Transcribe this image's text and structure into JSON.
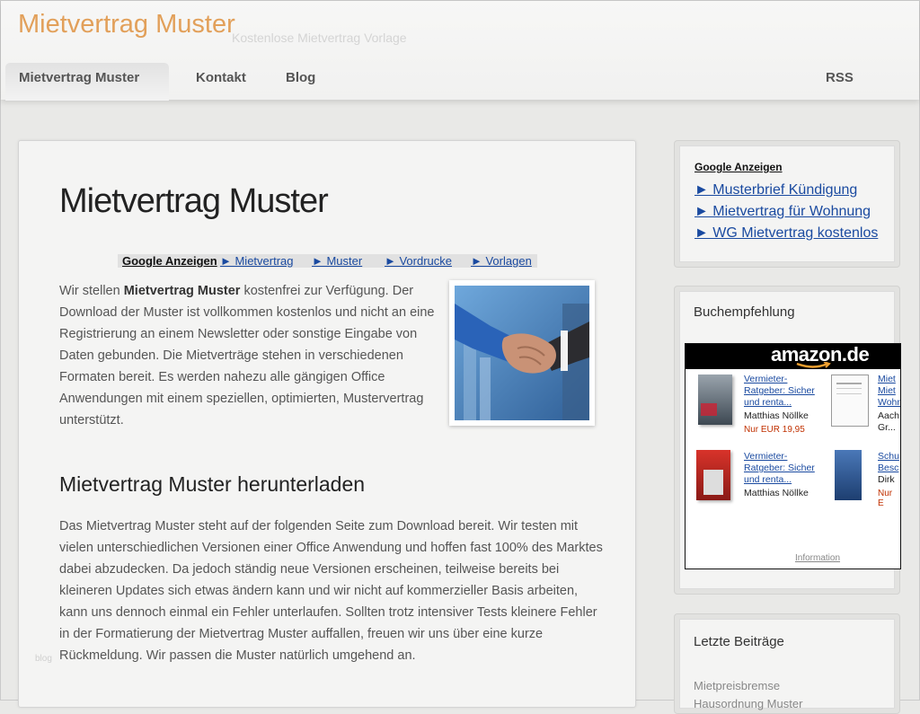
{
  "header": {
    "site_title": "Mietvertrag Muster",
    "tagline": "Kostenlose Mietvertrag Vorlage",
    "nav": [
      {
        "label": "Mietvertrag Muster",
        "active": true
      },
      {
        "label": "Kontakt"
      },
      {
        "label": "Blog"
      },
      {
        "label": "RSS"
      }
    ]
  },
  "main": {
    "heading": "Mietvertrag Muster",
    "ads": {
      "label": "Google Anzeigen",
      "links": [
        "► Mietvertrag",
        "► Muster",
        "► Vordrucke",
        "► Vorlagen"
      ]
    },
    "intro": {
      "before": "Wir stellen ",
      "bold": "Mietvertrag Muster",
      "after": " kostenfrei zur Verfügung. Der Download der Muster ist vollkommen kostenlos und nicht an eine Registrierung an einem Newsletter oder sonstige Eingabe von Daten gebunden. Die Mietverträge stehen in verschiedenen Formaten bereit. Es werden nahezu alle gängigen Office Anwendungen mit einem speziellen, optimierten, Mustervertrag unterstützt."
    },
    "subheading": "Mietvertrag Muster herunterladen",
    "paragraph": "Das Mietvertrag Muster steht auf der folgenden Seite zum Download bereit. Wir testen mit vielen unterschiedlichen Versionen einer Office Anwendung und hoffen fast 100% des Marktes dabei abzudecken. Da jedoch ständig neue Versionen erscheinen, teilweise bereits bei kleineren Updates sich etwas ändern kann und wir nicht auf kommerzieller Basis arbeiten, kann uns dennoch einmal ein Fehler unterlaufen. Sollten trotz intensiver Tests kleinere Fehler in der Formatierung der Mietvertrag Muster auffallen, freuen wir uns über eine kurze Rückmeldung. Wir passen die Muster natürlich umgehend an.",
    "watermark": "blog"
  },
  "sidebar": {
    "ads": {
      "label": "Google Anzeigen",
      "links": [
        "► Musterbrief Kündigung",
        "► Mietvertrag für Wohnung",
        "► WG Mietvertrag kostenlos"
      ]
    },
    "books": {
      "title": "Buchempfehlung",
      "logo": "amazon.de",
      "items": [
        {
          "title": "Vermieter-Ratgeber: Sicher und renta...",
          "author": "Matthias Nöllke",
          "price": "Nur EUR 19,95"
        },
        {
          "title": "Miet Miet Wohn",
          "author": "Aach Gr...",
          "price": ""
        },
        {
          "title": "Vermieter-Ratgeber: Sicher und renta...",
          "author": "Matthias Nöllke",
          "price": ""
        },
        {
          "title": "Schu Besc",
          "author": "Dirk",
          "price": "Nur E"
        }
      ],
      "info": "Information"
    },
    "recent": {
      "title": "Letzte Beiträge",
      "items": [
        "Mietpreisbremse",
        "Hausordnung Muster"
      ]
    }
  }
}
